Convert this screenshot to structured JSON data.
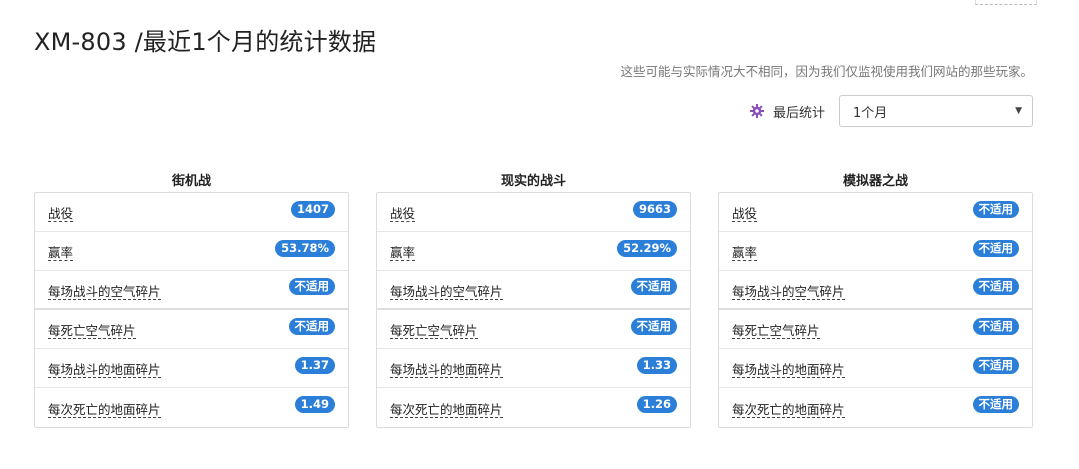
{
  "title": "XM-803 /最近1个月的统计数据",
  "subtitle": "这些可能与实际情况大不相同，因为我们仅监视使用我们网站的那些玩家。",
  "controls": {
    "icon": "gear-icon",
    "label": "最后统计",
    "period_selected": "1个月"
  },
  "colors": {
    "badge": "#2b7fd8",
    "gear": "#8a4fb8"
  },
  "columns": [
    {
      "title": "街机战",
      "rows": [
        {
          "label": "战役",
          "value": "1407"
        },
        {
          "label": "赢率",
          "value": "53.78%"
        },
        {
          "label": "每场战斗的空气碎片",
          "value": "不适用"
        },
        {
          "label": "每死亡空气碎片",
          "value": "不适用"
        },
        {
          "label": "每场战斗的地面碎片",
          "value": "1.37"
        },
        {
          "label": "每次死亡的地面碎片",
          "value": "1.49"
        }
      ]
    },
    {
      "title": "现实的战斗",
      "rows": [
        {
          "label": "战役",
          "value": "9663"
        },
        {
          "label": "赢率",
          "value": "52.29%"
        },
        {
          "label": "每场战斗的空气碎片",
          "value": "不适用"
        },
        {
          "label": "每死亡空气碎片",
          "value": "不适用"
        },
        {
          "label": "每场战斗的地面碎片",
          "value": "1.33"
        },
        {
          "label": "每次死亡的地面碎片",
          "value": "1.26"
        }
      ]
    },
    {
      "title": "模拟器之战",
      "rows": [
        {
          "label": "战役",
          "value": "不适用"
        },
        {
          "label": "赢率",
          "value": "不适用"
        },
        {
          "label": "每场战斗的空气碎片",
          "value": "不适用"
        },
        {
          "label": "每死亡空气碎片",
          "value": "不适用"
        },
        {
          "label": "每场战斗的地面碎片",
          "value": "不适用"
        },
        {
          "label": "每次死亡的地面碎片",
          "value": "不适用"
        }
      ]
    }
  ]
}
